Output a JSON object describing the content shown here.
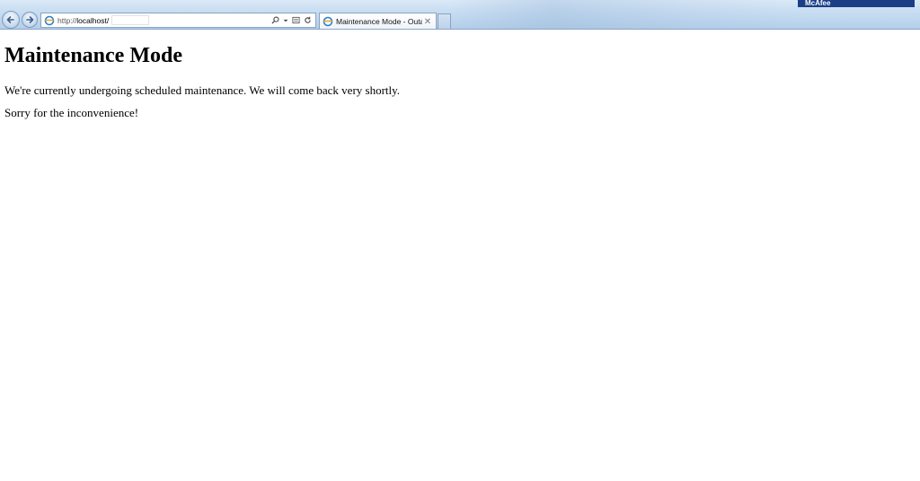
{
  "browser": {
    "address_bar": {
      "protocol": "http://",
      "host": "localhost/"
    },
    "tab": {
      "title": "Maintenance Mode - Outa..."
    },
    "toolbar_badge": "McAfee",
    "icons": {
      "back": "back-arrow-icon",
      "forward": "forward-arrow-icon",
      "page": "ie-page-icon",
      "search": "search-icon",
      "compat": "compatibility-view-icon",
      "refresh": "refresh-icon",
      "close": "close-icon"
    }
  },
  "page": {
    "heading": "Maintenance Mode",
    "message": "We're currently undergoing scheduled maintenance. We will come back very shortly.",
    "apology": "Sorry for the inconvenience!"
  },
  "colors": {
    "chrome_top": "#dbe9f7",
    "chrome_bottom": "#b4cfea",
    "mcafee_bar": "#1a3f86",
    "text": "#000000"
  }
}
